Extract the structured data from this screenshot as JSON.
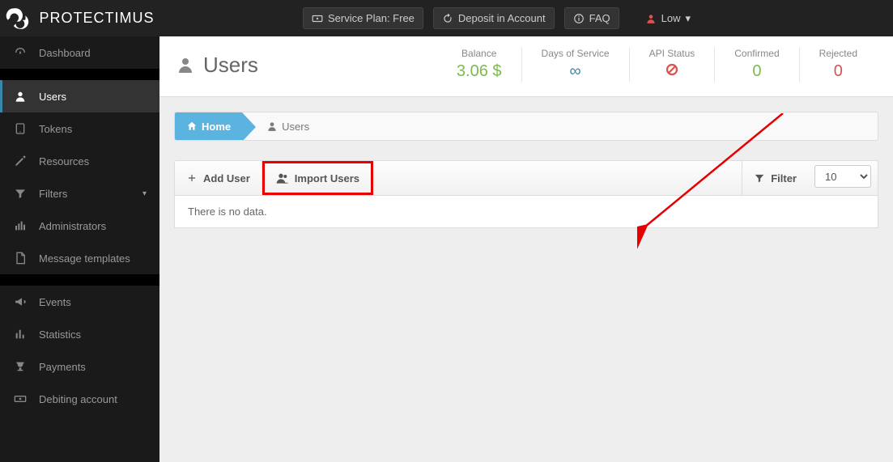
{
  "brand": "PROTECTIMUS",
  "topbar": {
    "service_plan": "Service Plan: Free",
    "deposit": "Deposit in Account",
    "faq": "FAQ",
    "user_level": "Low"
  },
  "sidebar": {
    "dashboard": "Dashboard",
    "users": "Users",
    "tokens": "Tokens",
    "resources": "Resources",
    "filters": "Filters",
    "administrators": "Administrators",
    "message_templates": "Message templates",
    "events": "Events",
    "statistics": "Statistics",
    "payments": "Payments",
    "debiting": "Debiting account"
  },
  "page": {
    "title": "Users",
    "stats": {
      "balance_label": "Balance",
      "balance_value": "3.06 $",
      "days_label": "Days of Service",
      "days_value": "∞",
      "api_label": "API Status",
      "confirmed_label": "Confirmed",
      "confirmed_value": "0",
      "rejected_label": "Rejected",
      "rejected_value": "0"
    }
  },
  "breadcrumb": {
    "home": "Home",
    "users": "Users"
  },
  "toolbar": {
    "add_user": "Add User",
    "import_users": "Import Users",
    "filter": "Filter",
    "page_size": "10"
  },
  "table": {
    "empty": "There is no data."
  }
}
